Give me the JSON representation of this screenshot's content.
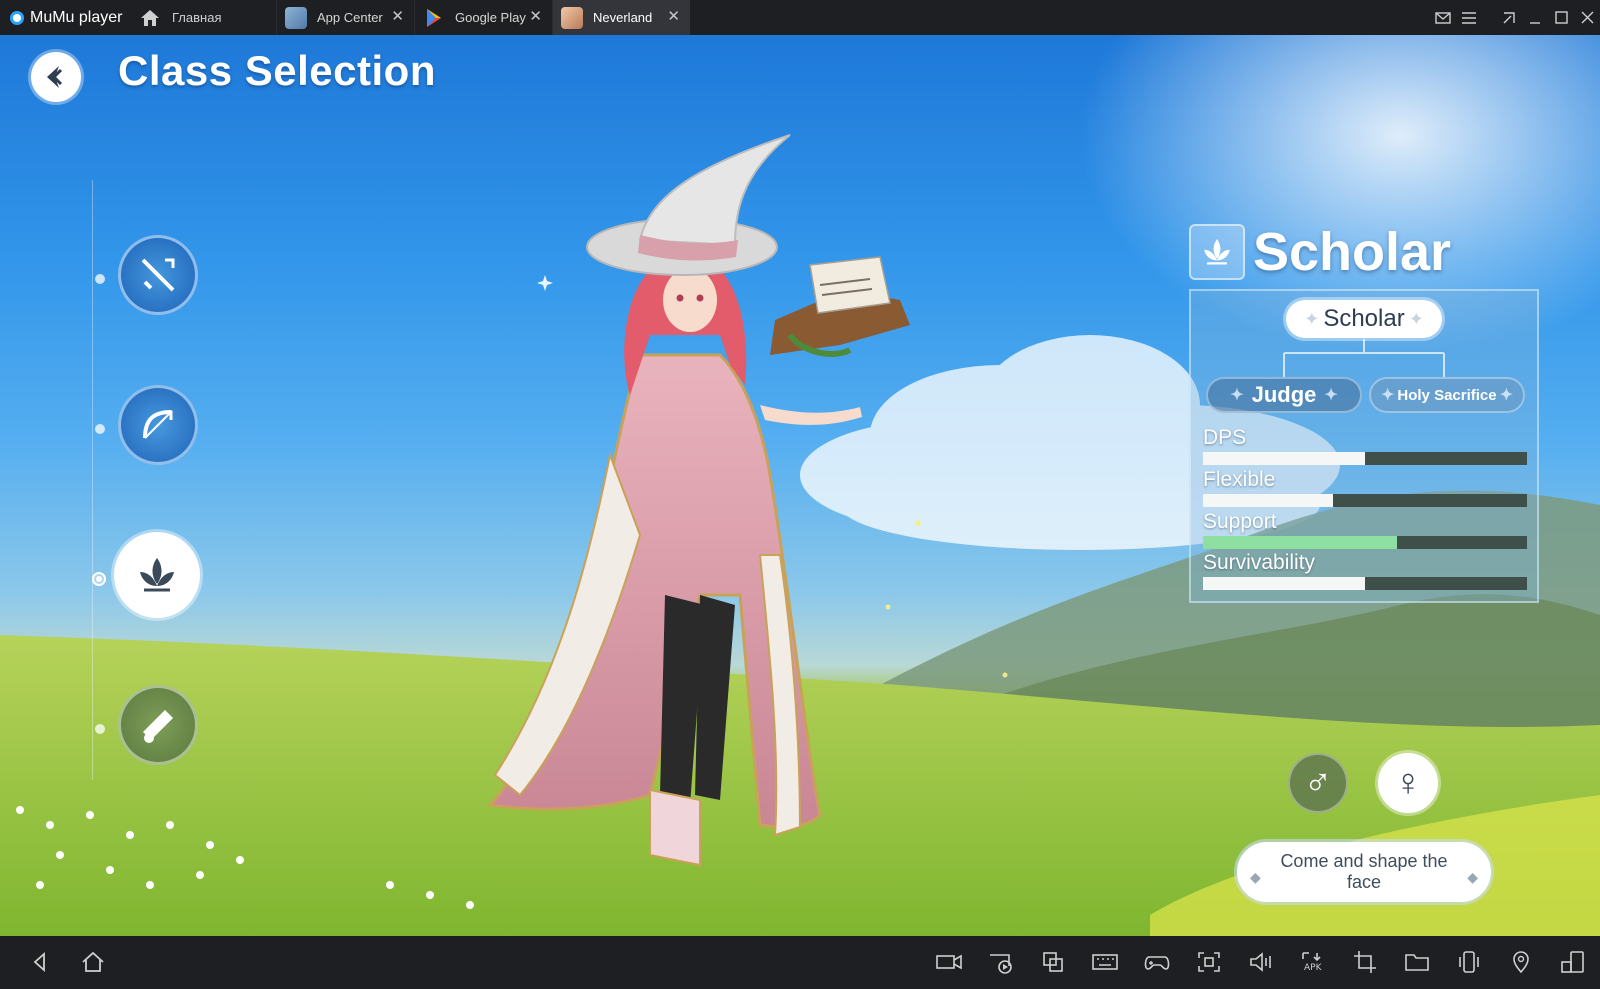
{
  "window": {
    "brand": "MuMu player",
    "home_tab": "Главная",
    "tabs": [
      {
        "label": "App Center",
        "close": "✕",
        "active": false
      },
      {
        "label": "Google Play",
        "close": "✕",
        "active": false
      },
      {
        "label": "Neverland",
        "close": "✕",
        "active": true
      }
    ],
    "controls": [
      "mail-icon",
      "menu-icon",
      "pin-icon",
      "minimize-icon",
      "maximize-icon",
      "close-icon"
    ]
  },
  "game": {
    "title": "Class Selection",
    "classes": [
      {
        "id": "warrior",
        "icon": "sword-icon",
        "selected": false
      },
      {
        "id": "archer",
        "icon": "bow-icon",
        "selected": false
      },
      {
        "id": "scholar",
        "icon": "lotus-icon",
        "selected": true
      },
      {
        "id": "gunner",
        "icon": "cannon-icon",
        "selected": false
      }
    ],
    "selected_class": "Scholar",
    "tree": {
      "root": "Scholar",
      "branches": [
        "Judge",
        "Holy Sacrifice"
      ]
    },
    "stats": [
      {
        "label": "DPS",
        "value": 0.5,
        "highlight": false
      },
      {
        "label": "Flexible",
        "value": 0.4,
        "highlight": false
      },
      {
        "label": "Support",
        "value": 0.6,
        "highlight": true
      },
      {
        "label": "Survivability",
        "value": 0.5,
        "highlight": false
      }
    ],
    "gender": {
      "male_symbol": "♂",
      "female_symbol": "♀",
      "selected": "female"
    },
    "customize_label": "Come and shape the face",
    "colors": {
      "support_bar": "#8ee0a2",
      "bar_track": "#3f4f4a"
    }
  },
  "bottombar": {
    "nav": [
      "back-icon",
      "home-icon"
    ],
    "tools": [
      "record-icon",
      "screen-cast-icon",
      "multi-window-icon",
      "keyboard-icon",
      "gamepad-icon",
      "screenshot-icon",
      "volume-icon",
      "apk-icon",
      "crop-icon",
      "folder-icon",
      "shake-icon",
      "location-icon",
      "rotate-icon"
    ]
  }
}
